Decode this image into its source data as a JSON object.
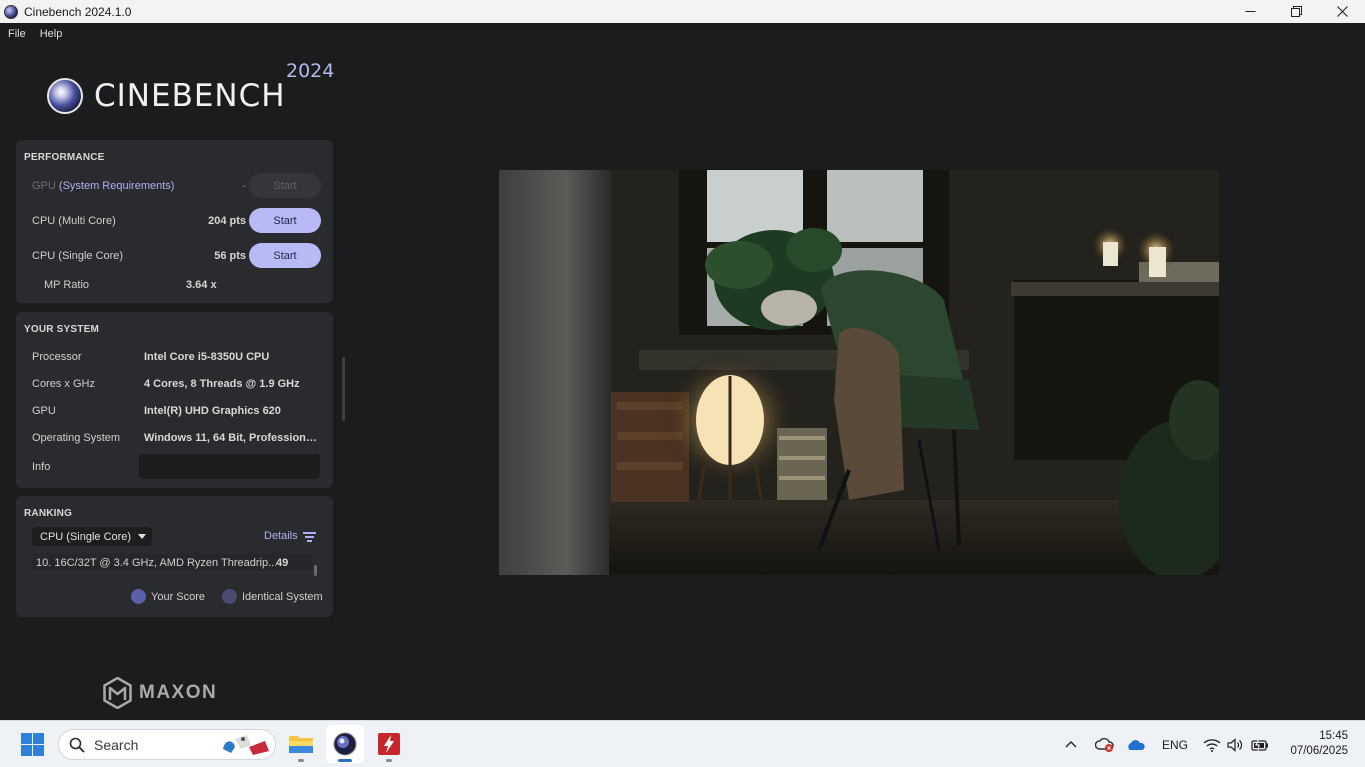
{
  "window": {
    "title": "Cinebench 2024.1.0"
  },
  "menu": [
    "File",
    "Help"
  ],
  "logo": {
    "name": "CINEBENCH",
    "year": "2024"
  },
  "performance": {
    "title": "PERFORMANCE",
    "gpu": {
      "label": "GPU",
      "link": "(System Requirements)",
      "score": "-",
      "button": "Start"
    },
    "cpu_multi": {
      "label": "CPU (Multi Core)",
      "score": "204 pts",
      "button": "Start"
    },
    "cpu_single": {
      "label": "CPU (Single Core)",
      "score": "56 pts",
      "button": "Start"
    },
    "mp_ratio": {
      "label": "MP Ratio",
      "value": "3.64 x"
    }
  },
  "system": {
    "title": "YOUR SYSTEM",
    "rows": [
      {
        "key": "Processor",
        "value": "Intel Core i5-8350U CPU"
      },
      {
        "key": "Cores x GHz",
        "value": "4 Cores, 8 Threads @ 1.9 GHz"
      },
      {
        "key": "GPU",
        "value": "Intel(R) UHD Graphics 620"
      },
      {
        "key": "Operating System",
        "value": "Windows 11, 64 Bit, Professional..."
      }
    ],
    "info_label": "Info",
    "info_value": ""
  },
  "ranking": {
    "title": "RANKING",
    "selected": "CPU (Single Core)",
    "details": "Details",
    "entry": {
      "name": "10. 16C/32T @ 3.4 GHz, AMD Ryzen Threadrip...",
      "score": "49"
    },
    "legend_your": "Your Score",
    "legend_identical": "Identical System",
    "colors": {
      "your_score": "#5c5fa8",
      "identical": "#4a4b70"
    }
  },
  "footer_logo": "MAXON",
  "taskbar": {
    "search_placeholder": "Search",
    "language": "ENG",
    "time": "15:45",
    "date": "07/06/2025"
  },
  "accent": "#b7baf5"
}
